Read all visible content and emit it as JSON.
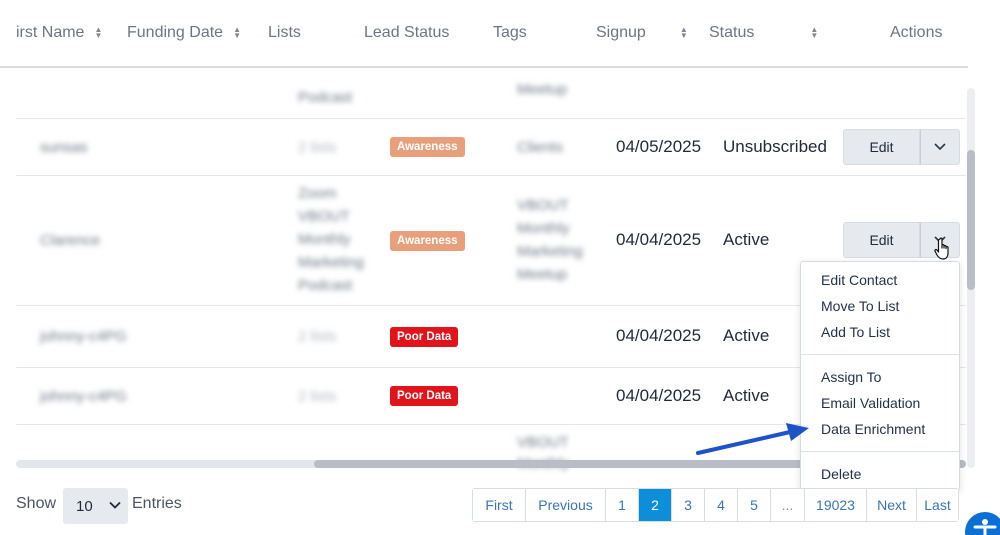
{
  "columns": {
    "first_name": "irst Name",
    "funding_date": "Funding Date",
    "lists": "Lists",
    "lead_status": "Lead Status",
    "tags": "Tags",
    "signup": "Signup",
    "status": "Status",
    "actions": "Actions"
  },
  "rows": [
    {
      "first_name": "",
      "count": "",
      "lists": [
        "Podcast"
      ],
      "lead_status": "",
      "tags": [
        "Meetup"
      ],
      "signup": "",
      "status": ""
    },
    {
      "first_name": "sunsas",
      "count": "2 lists",
      "lists": [],
      "lead_status": "Awareness",
      "tags": [
        "Clients"
      ],
      "signup": "04/05/2025",
      "status": "Unsubscribed"
    },
    {
      "first_name": "Clarence",
      "count": "",
      "lists": [
        "Zoom",
        "VBOUT",
        "Monthly",
        "Marketing",
        "Podcast"
      ],
      "lead_status": "Awareness",
      "tags": [
        "VBOUT",
        "Monthly",
        "Marketing",
        "Meetup"
      ],
      "signup": "04/04/2025",
      "status": "Active"
    },
    {
      "first_name": "johnny-c4PG",
      "count": "2 lists",
      "lists": [],
      "lead_status": "Poor Data",
      "tags": [],
      "signup": "04/04/2025",
      "status": "Active"
    },
    {
      "first_name": "johnny-c4PG",
      "count": "2 lists",
      "lists": [],
      "lead_status": "Poor Data",
      "tags": [],
      "signup": "04/04/2025",
      "status": "Active"
    },
    {
      "first_name": "",
      "count": "",
      "lists": [],
      "lead_status": "",
      "tags": [
        "VBOUT",
        "Monthly"
      ],
      "signup": "",
      "status": ""
    }
  ],
  "actions": {
    "edit_label": "Edit"
  },
  "dropdown_menu": {
    "items": [
      "Edit Contact",
      "Move To List",
      "Add To List",
      "Assign To",
      "Email Validation",
      "Data Enrichment",
      "Delete"
    ]
  },
  "footer": {
    "show_label": "Show",
    "entries_label": "Entries",
    "page_size": "10",
    "pagination": [
      "First",
      "Previous",
      "1",
      "2",
      "3",
      "4",
      "5",
      "...",
      "19023",
      "Next",
      "Last"
    ],
    "current_page": "2"
  },
  "colors": {
    "awareness_badge": "#e8a07c",
    "poor_data_badge": "#e2141b",
    "active_page": "#0d8ed9",
    "annotation_arrow": "#1f52c9"
  }
}
